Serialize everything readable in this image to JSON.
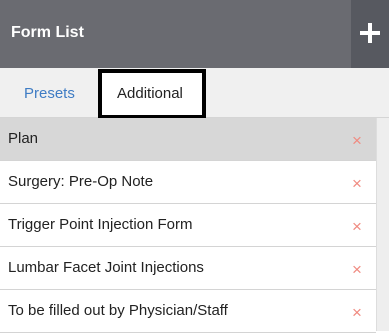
{
  "header": {
    "title": "Form List",
    "add_icon": "plus-icon"
  },
  "tabs": [
    {
      "label": "Presets",
      "color": "#3f7cc4"
    },
    {
      "label": "Additional",
      "active": true
    }
  ],
  "forms": [
    {
      "name": "Plan",
      "selected": true
    },
    {
      "name": "Surgery: Pre-Op Note"
    },
    {
      "name": "Trigger Point Injection Form"
    },
    {
      "name": "Lumbar Facet Joint Injections"
    },
    {
      "name": "To be filled out by Physician/Staff"
    }
  ],
  "remove_icon": "×",
  "colors": {
    "header": "#6a6b71",
    "remove": "#f08a80",
    "selected_row": "#d7d7d7"
  }
}
